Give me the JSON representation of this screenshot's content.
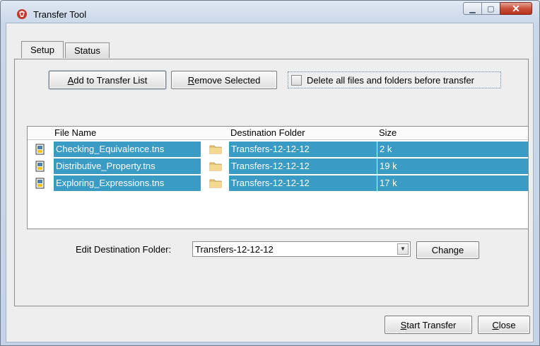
{
  "window": {
    "title": "Transfer Tool"
  },
  "tabs": [
    {
      "label": "Setup"
    },
    {
      "label": "Status"
    }
  ],
  "toolbar": {
    "add_mnemonic": "A",
    "add_rest": "dd to Transfer List",
    "remove_mnemonic": "R",
    "remove_rest": "emove Selected",
    "delete_all_label": "Delete all files and folders before transfer"
  },
  "table": {
    "headers": {
      "file": "File Name",
      "dest": "Destination Folder",
      "size": "Size"
    },
    "rows": [
      {
        "file": "Checking_Equivalence.tns",
        "dest": "Transfers-12-12-12",
        "size": "2 k"
      },
      {
        "file": "Distributive_Property.tns",
        "dest": "Transfers-12-12-12",
        "size": "19 k"
      },
      {
        "file": "Exploring_Expressions.tns",
        "dest": "Transfers-12-12-12",
        "size": "17 k"
      }
    ],
    "selection_color": "#3a9bc4"
  },
  "dest": {
    "label": "Edit Destination Folder:",
    "value": "Transfers-12-12-12",
    "change_label": "Change"
  },
  "footer": {
    "start_mnemonic": "S",
    "start_rest": "tart Transfer",
    "close_mnemonic": "C",
    "close_rest": "lose"
  },
  "icons": {
    "app": "ti-logo-icon",
    "file": "tns-file-icon",
    "folder": "folder-icon"
  }
}
